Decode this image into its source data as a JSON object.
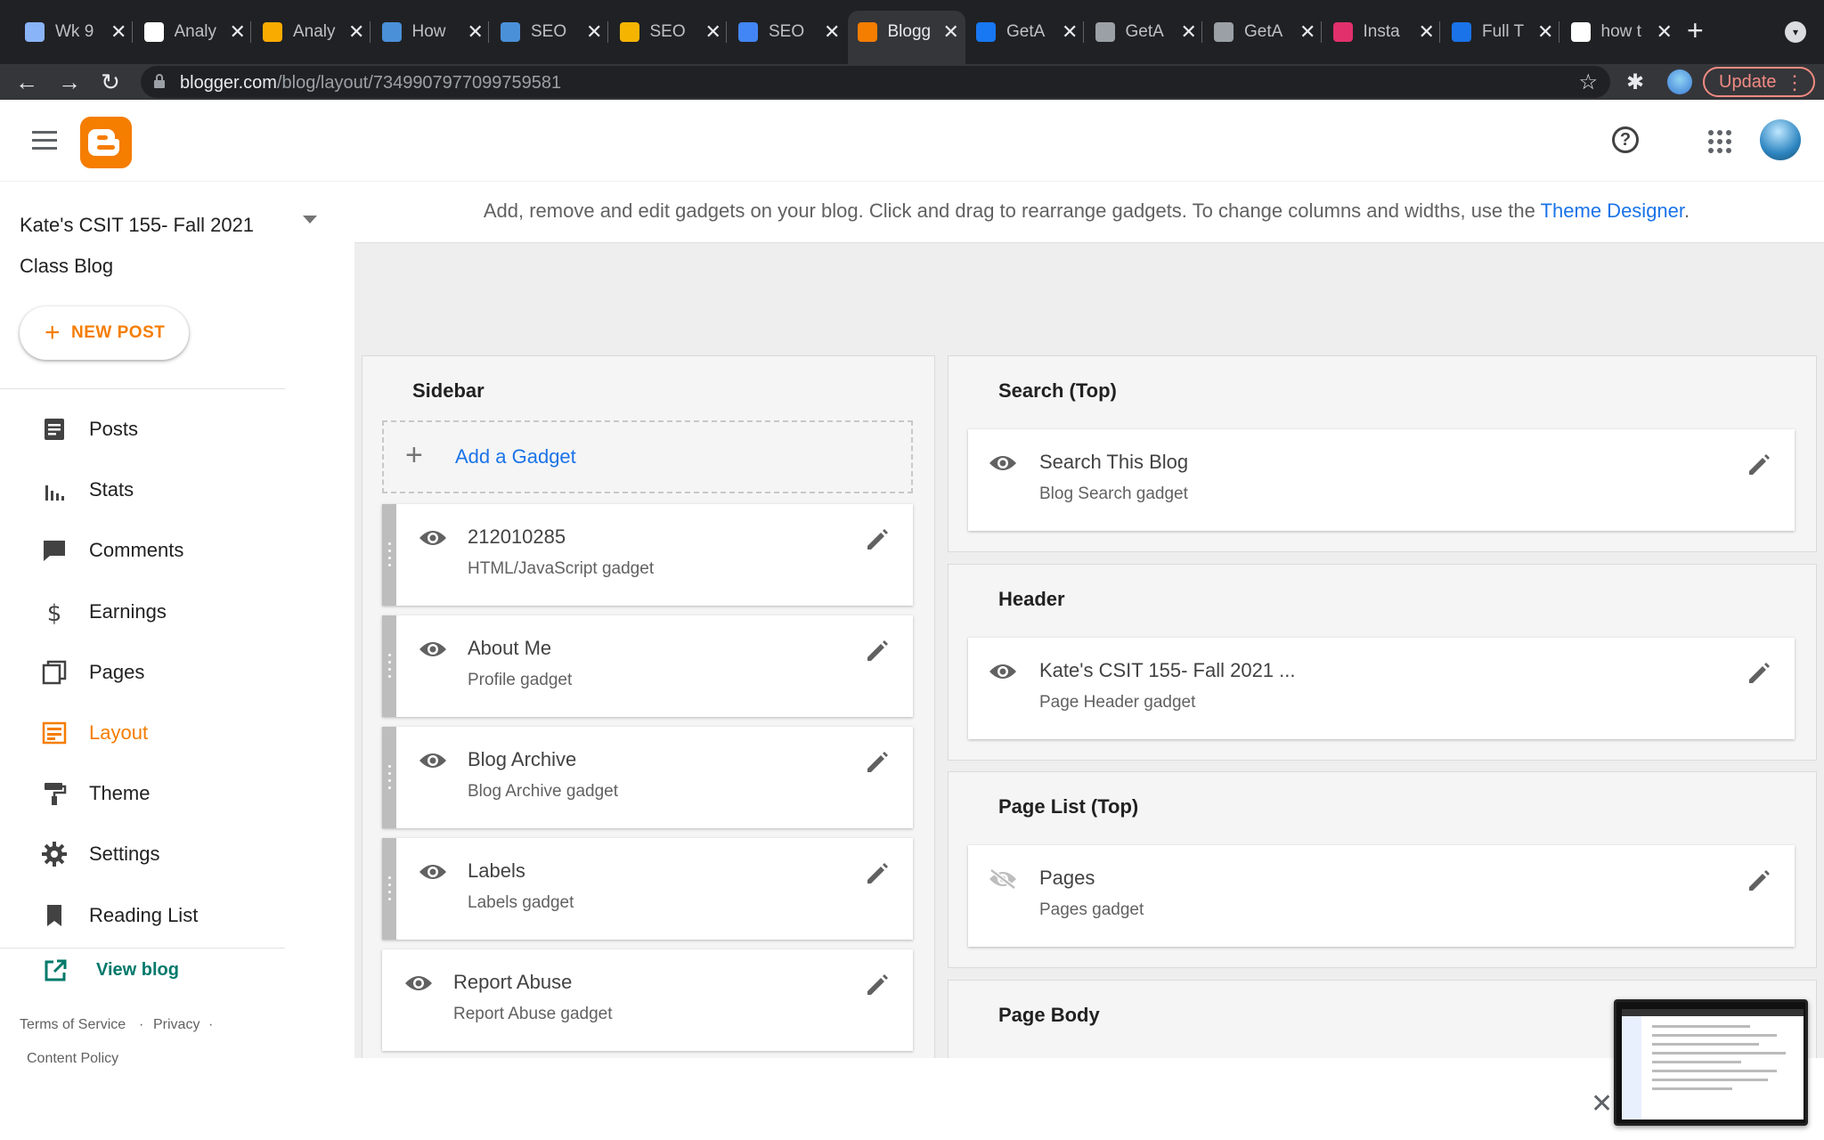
{
  "browser": {
    "tabs": [
      {
        "title": "Wk 9",
        "icon": "spinner-icon",
        "color": "#8ab4f8"
      },
      {
        "title": "Analy",
        "icon": "google-icon",
        "color": "#ffffff"
      },
      {
        "title": "Analy",
        "icon": "analytics-icon",
        "color": "#f9ab00"
      },
      {
        "title": "How",
        "icon": "mailchimp-icon",
        "color": "#4a90d9"
      },
      {
        "title": "SEO",
        "icon": "mailchimp-icon",
        "color": "#4a90d9"
      },
      {
        "title": "SEO",
        "icon": "stripes-icon",
        "color": "#f4b400"
      },
      {
        "title": "SEO",
        "icon": "docs-icon",
        "color": "#4285f4"
      },
      {
        "title": "Blogg",
        "icon": "blogger-icon",
        "color": "#f57d00"
      },
      {
        "title": "GetA",
        "icon": "facebook-icon",
        "color": "#1877f2"
      },
      {
        "title": "GetA",
        "icon": "print-icon",
        "color": "#9aa0a6"
      },
      {
        "title": "GetA",
        "icon": "print-icon",
        "color": "#9aa0a6"
      },
      {
        "title": "Insta",
        "icon": "instagram-icon",
        "color": "#e1306c"
      },
      {
        "title": "Full T",
        "icon": "info-icon",
        "color": "#1a73e8"
      },
      {
        "title": "how t",
        "icon": "google-icon",
        "color": "#ffffff"
      }
    ],
    "url_host": "blogger.com",
    "url_path": "/blog/layout/7349907977099759581",
    "update_label": "Update"
  },
  "sidebar": {
    "blog_title": "Kate's CSIT 155- Fall 2021 Class Blog",
    "new_post_label": "NEW POST",
    "items": [
      {
        "label": "Posts",
        "icon": "posts-icon"
      },
      {
        "label": "Stats",
        "icon": "stats-icon"
      },
      {
        "label": "Comments",
        "icon": "comments-icon"
      },
      {
        "label": "Earnings",
        "icon": "dollar-icon"
      },
      {
        "label": "Pages",
        "icon": "pages-icon"
      },
      {
        "label": "Layout",
        "icon": "layout-icon",
        "active": true
      },
      {
        "label": "Theme",
        "icon": "paint-roller-icon"
      },
      {
        "label": "Settings",
        "icon": "gear-icon"
      },
      {
        "label": "Reading List",
        "icon": "bookmark-icon"
      }
    ],
    "view_blog_label": "View blog",
    "footer": {
      "terms": "Terms of Service",
      "privacy": "Privacy",
      "content_policy": "Content Policy",
      "separator": "·"
    }
  },
  "main": {
    "info_text": "Add, remove and edit gadgets on your blog. Click and drag to rearrange gadgets. To change columns and widths, use the",
    "info_link": "Theme Designer",
    "info_end": ".",
    "sidebar_section": {
      "title": "Sidebar",
      "add_gadget_label": "Add a Gadget",
      "gadgets": [
        {
          "name": "212010285",
          "type": "HTML/JavaScript gadget",
          "visible": true,
          "draggable": true
        },
        {
          "name": "About Me",
          "type": "Profile gadget",
          "visible": true,
          "draggable": true
        },
        {
          "name": "Blog Archive",
          "type": "Blog Archive gadget",
          "visible": true,
          "draggable": true
        },
        {
          "name": "Labels",
          "type": "Labels gadget",
          "visible": true,
          "draggable": true
        },
        {
          "name": "Report Abuse",
          "type": "Report Abuse gadget",
          "visible": true,
          "draggable": false
        }
      ]
    },
    "right_sections": [
      {
        "title": "Search (Top)",
        "gadget": {
          "name": "Search This Blog",
          "type": "Blog Search gadget",
          "visible": true
        }
      },
      {
        "title": "Header",
        "gadget": {
          "name": "Kate's CSIT 155- Fall 2021 ...",
          "type": "Page Header gadget",
          "visible": true
        }
      },
      {
        "title": "Page List (Top)",
        "gadget": {
          "name": "Pages",
          "type": "Pages gadget",
          "visible": false
        }
      },
      {
        "title": "Page Body"
      }
    ]
  },
  "colors": {
    "brand": "#f57d00",
    "link": "#1a73e8",
    "view_blog": "#00796b"
  }
}
